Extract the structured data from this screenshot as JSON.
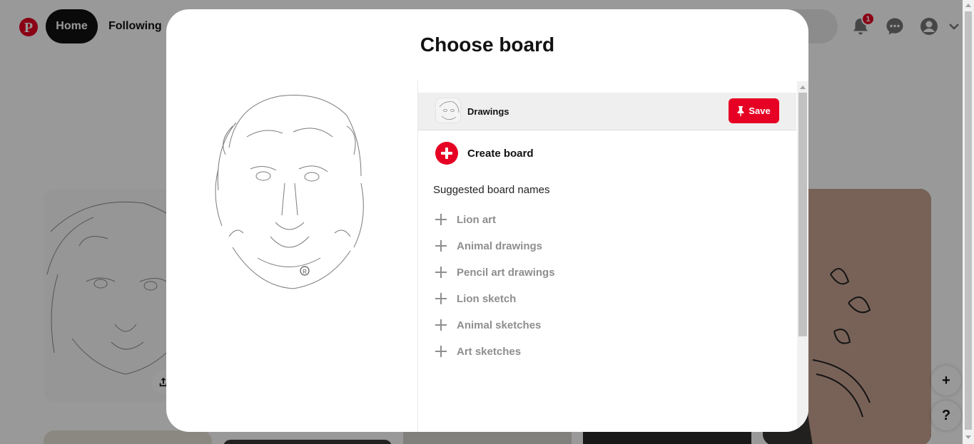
{
  "topbar": {
    "home_label": "Home",
    "following_label": "Following",
    "notification_count": "1",
    "icons": [
      "pinterest-logo",
      "bell-icon",
      "chat-icon",
      "user-avatar-icon",
      "chevron-down-icon"
    ]
  },
  "floating": {
    "add_label": "+",
    "help_label": "?"
  },
  "modal": {
    "title": "Choose board",
    "selected_board": {
      "name": "Drawings",
      "save_label": "Save"
    },
    "create_board_label": "Create board",
    "suggested_heading": "Suggested board names",
    "suggestions": [
      "Lion art",
      "Animal drawings",
      "Pencil art drawings",
      "Lion sketch",
      "Animal sketches",
      "Art sketches"
    ]
  },
  "colors": {
    "brand_red": "#e60023",
    "suggestion_gray": "#8e8e8e",
    "overlay": "rgba(0,0,0,0.4)"
  }
}
